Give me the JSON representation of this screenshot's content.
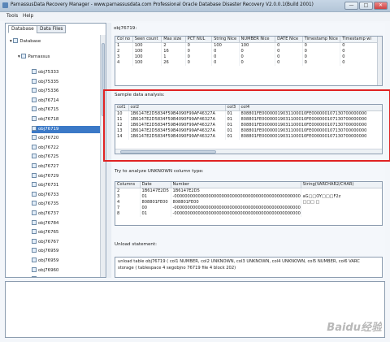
{
  "window": {
    "title": "ParnassusData Recovery Manager - www.parnassusdata.com  Professional Oracle Database Disaster Recovery   V2.0.0.1(Build 2001)",
    "controls": {
      "minimize": "—",
      "maximize": "□",
      "close": "✕"
    }
  },
  "menu": {
    "tools": "Tools",
    "help": "Help"
  },
  "left": {
    "tabs": [
      {
        "label": "Database",
        "active": true
      },
      {
        "label": "Data Files",
        "active": false
      }
    ],
    "root": "Database",
    "schema": "Parnassus",
    "objects": [
      "obj75333",
      "obj75335",
      "obj75336",
      "obj76714",
      "obj76715",
      "obj76718",
      "obj76719",
      "obj76720",
      "obj76722",
      "obj76725",
      "obj76727",
      "obj76729",
      "obj76731",
      "obj76733",
      "obj76735",
      "obj76737",
      "obj76784",
      "obj76765",
      "obj76767",
      "obj76959",
      "obj76959",
      "obj76960",
      "obj76961",
      "obj76962"
    ],
    "selected_index": 6
  },
  "right": {
    "header": "obj76719:",
    "columns_table": {
      "headers": [
        "Col no",
        "Seen count",
        "Max size",
        "PCT NUL",
        "String Nice",
        "NUMBER Nice",
        "DATE Nice",
        "Timestamp Nice",
        "Timestamp wi"
      ],
      "rows": [
        [
          "1",
          "100",
          "2",
          "0",
          "100",
          "100",
          "0",
          "0",
          "0"
        ],
        [
          "2",
          "100",
          "16",
          "0",
          "0",
          "0",
          "0",
          "0",
          "0"
        ],
        [
          "3",
          "100",
          "1",
          "0",
          "0",
          "0",
          "0",
          "0",
          "0"
        ],
        [
          "4",
          "100",
          "26",
          "0",
          "0",
          "0",
          "0",
          "0",
          "0"
        ]
      ]
    },
    "sample_label": "Sample data analysis:",
    "sample_table": {
      "headers": [
        "col1",
        "col2",
        "col3",
        "col4"
      ],
      "rows": [
        [
          "10",
          "1B6147E2D5834F59B4090F99AF46327A",
          "01",
          "808801FE00000019031100010FE000000107130700000000"
        ],
        [
          "11",
          "1B6147E2D5834F59B4090F99AF46327A",
          "01",
          "808801FE00000019031100010FE000000107130700000000"
        ],
        [
          "12",
          "1B6147E2D5834F59B4090F99AF46327A",
          "01",
          "808801FE00000019031100010FE000000107130700000000"
        ],
        [
          "13",
          "1B6147E2D5834F59B4090F99AF46327A",
          "01",
          "808801FE00000019031100010FE000000107130700000000"
        ],
        [
          "14",
          "1B6147E2D5834F59B4090F99AF46327A",
          "01",
          "808801FE00000019031100010FE000000107130700000000"
        ]
      ]
    },
    "unknown_label": "Try to analyze UNKNOWN column type:",
    "unknown_table": {
      "headers": [
        "Columns",
        "Date",
        "Number",
        "String(VARCHAR2/CHAR)"
      ],
      "rows": [
        [
          "2",
          "1B6147E2D5",
          "1B6147E2D5",
          ""
        ],
        [
          "3",
          "01",
          "-000000000000000000000000000000000000000000000000",
          "aG□□OY□□□F2z"
        ],
        [
          "4",
          "808801FE00",
          "808801FE00",
          "□□□  □"
        ],
        [
          "7",
          "00",
          "-000000000000000000000000000000000000000000000000",
          ""
        ],
        [
          "8",
          "01",
          "-000000000000000000000000000000000000000000000000",
          ""
        ]
      ]
    },
    "unload_label": "Unload statement:",
    "unload_text": [
      "unload table obj76719 ( col1 NUMBER, col2 UNKNOWN, col3 UNKNOWN, col4 UNKNOWN, col5 NUMBER, col6 VARC",
      "storage ( tablespace 4 segobjno 76719 file 4 block 202)"
    ]
  },
  "watermark": "Baidu经验",
  "colors": {
    "selection": "#3b79c7",
    "highlight_box": "#e02222",
    "titlebar": "#b3c5d8"
  }
}
